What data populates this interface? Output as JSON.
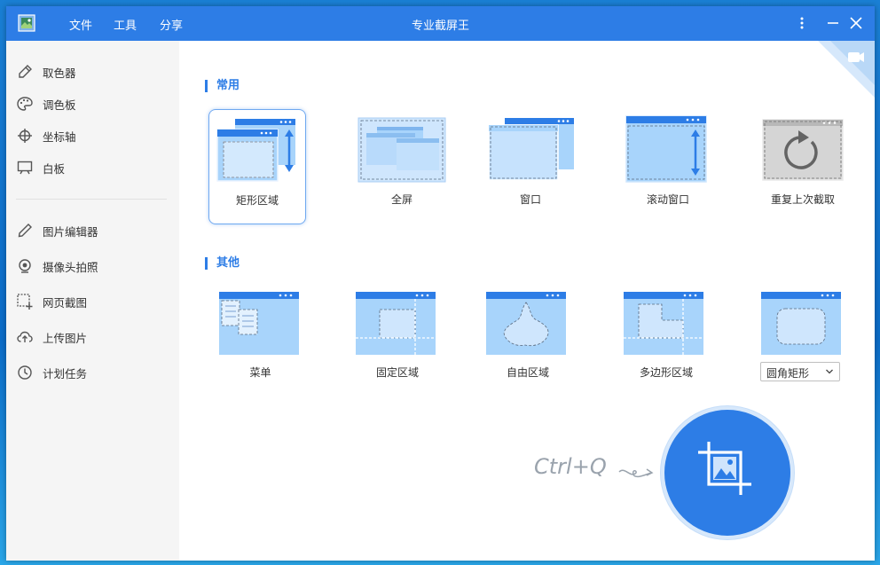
{
  "app": {
    "title": "专业截屏王",
    "menu": [
      "文件",
      "工具",
      "分享"
    ]
  },
  "sidebar": {
    "tools": [
      {
        "label": "取色器",
        "icon": "eyedropper-icon"
      },
      {
        "label": "调色板",
        "icon": "palette-icon"
      },
      {
        "label": "坐标轴",
        "icon": "crosshair-icon"
      },
      {
        "label": "白板",
        "icon": "whiteboard-icon"
      }
    ],
    "features": [
      {
        "label": "图片编辑器",
        "icon": "pencil-icon"
      },
      {
        "label": "摄像头拍照",
        "icon": "webcam-icon"
      },
      {
        "label": "网页截图",
        "icon": "webpage-capture-icon"
      },
      {
        "label": "上传图片",
        "icon": "cloud-upload-icon"
      },
      {
        "label": "计划任务",
        "icon": "clock-icon"
      }
    ]
  },
  "sections": {
    "common": {
      "title": "常用",
      "modes": [
        {
          "label": "矩形区域",
          "icon": "rect-region-icon",
          "selected": true
        },
        {
          "label": "全屏",
          "icon": "fullscreen-icon",
          "selected": false
        },
        {
          "label": "窗口",
          "icon": "window-icon",
          "selected": false
        },
        {
          "label": "滚动窗口",
          "icon": "scroll-window-icon",
          "selected": false
        },
        {
          "label": "重复上次截取",
          "icon": "repeat-capture-icon",
          "selected": false
        }
      ]
    },
    "other": {
      "title": "其他",
      "modes": [
        {
          "label": "菜单",
          "icon": "menu-capture-icon"
        },
        {
          "label": "固定区域",
          "icon": "fixed-region-icon"
        },
        {
          "label": "自由区域",
          "icon": "freeform-region-icon"
        },
        {
          "label": "多边形区域",
          "icon": "polygon-region-icon"
        }
      ],
      "shape_select": {
        "value": "圆角矩形"
      }
    }
  },
  "capture": {
    "hotkey": "Ctrl+Q",
    "icon": "crop-image-icon"
  },
  "colors": {
    "accent": "#2d7de6",
    "sidebar_bg": "#f5f5f5",
    "window_blue": "#9dd0fa"
  }
}
